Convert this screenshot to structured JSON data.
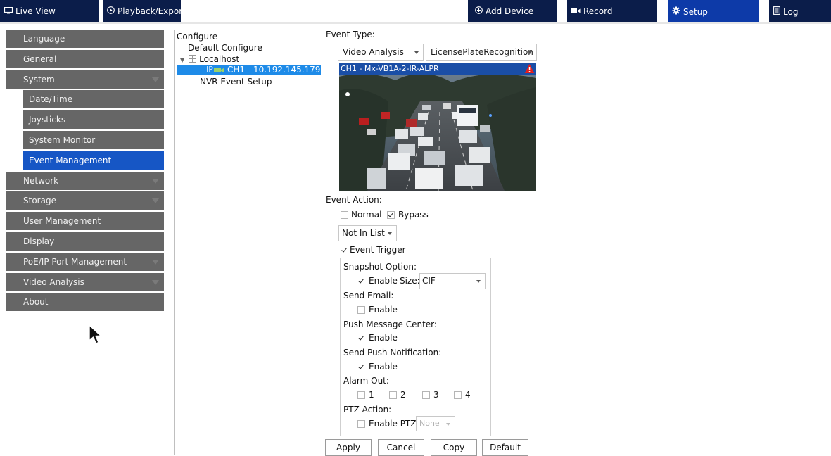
{
  "topbar": {
    "tabs": [
      {
        "label": "Live View",
        "icon": "monitor-icon"
      },
      {
        "label": "Playback/Export",
        "icon": "play-circle-icon"
      },
      {
        "label": "Add Device",
        "icon": "plus-circle-icon"
      },
      {
        "label": "Record",
        "icon": "record-icon"
      },
      {
        "label": "Setup",
        "icon": "gear-icon"
      },
      {
        "label": "Log",
        "icon": "document-icon"
      }
    ],
    "active_tab": "Setup"
  },
  "menu": {
    "items": [
      {
        "label": "Language"
      },
      {
        "label": "General"
      },
      {
        "label": "System",
        "expandable": true
      },
      {
        "label": "Date/Time",
        "sub": true
      },
      {
        "label": "Joysticks",
        "sub": true
      },
      {
        "label": "System Monitor",
        "sub": true
      },
      {
        "label": "Event Management",
        "sub": true,
        "active": true
      },
      {
        "label": "Network",
        "expandable": true
      },
      {
        "label": "Storage",
        "expandable": true
      },
      {
        "label": "User Management"
      },
      {
        "label": "Display"
      },
      {
        "label": "PoE/IP Port Management",
        "expandable": true
      },
      {
        "label": "Video Analysis",
        "expandable": true
      },
      {
        "label": "About"
      }
    ]
  },
  "tree": {
    "header": "Configure",
    "default_configure": "Default Configure",
    "localhost": "Localhost",
    "channel_prefix": "IP",
    "channel": "CH1 - 10.192.145.179",
    "nvr_event_setup": "NVR Event Setup"
  },
  "event": {
    "type_label": "Event Type:",
    "type_value": "Video Analysis",
    "subtype_value": "LicensePlateRecognition",
    "video_title": "CH1 - Mx-VB1A-2-IR-ALPR",
    "action_label": "Event Action:",
    "normal_label": "Normal",
    "normal_checked": false,
    "bypass_label": "Bypass",
    "bypass_checked": true,
    "list_value": "Not In List",
    "event_trigger_label": "Event Trigger",
    "event_trigger_checked": true,
    "snapshot_label": "Snapshot Option:",
    "snapshot_enable": "Enable",
    "snapshot_checked": true,
    "size_label": "Size:",
    "size_value": "CIF",
    "send_email_label": "Send Email:",
    "send_email_enable": "Enable",
    "send_email_checked": false,
    "push_center_label": "Push Message Center:",
    "push_center_enable": "Enable",
    "push_center_checked": true,
    "push_notif_label": "Send Push Notification:",
    "push_notif_enable": "Enable",
    "push_notif_checked": true,
    "alarm_out_label": "Alarm Out:",
    "alarm_outs": [
      "1",
      "2",
      "3",
      "4"
    ],
    "ptz_label": "PTZ Action:",
    "ptz_enable": "Enable PTZ",
    "ptz_checked": false,
    "ptz_value": "None"
  },
  "buttons": {
    "apply": "Apply",
    "cancel": "Cancel",
    "copy": "Copy",
    "default": "Default"
  },
  "colors": {
    "tab_bg": "#0b1d4a",
    "tab_active": "#0d3aa8",
    "menu_bg": "#666666",
    "menu_active": "#1656c5",
    "tree_selection": "#1e8be8",
    "warning": "#e02020"
  }
}
